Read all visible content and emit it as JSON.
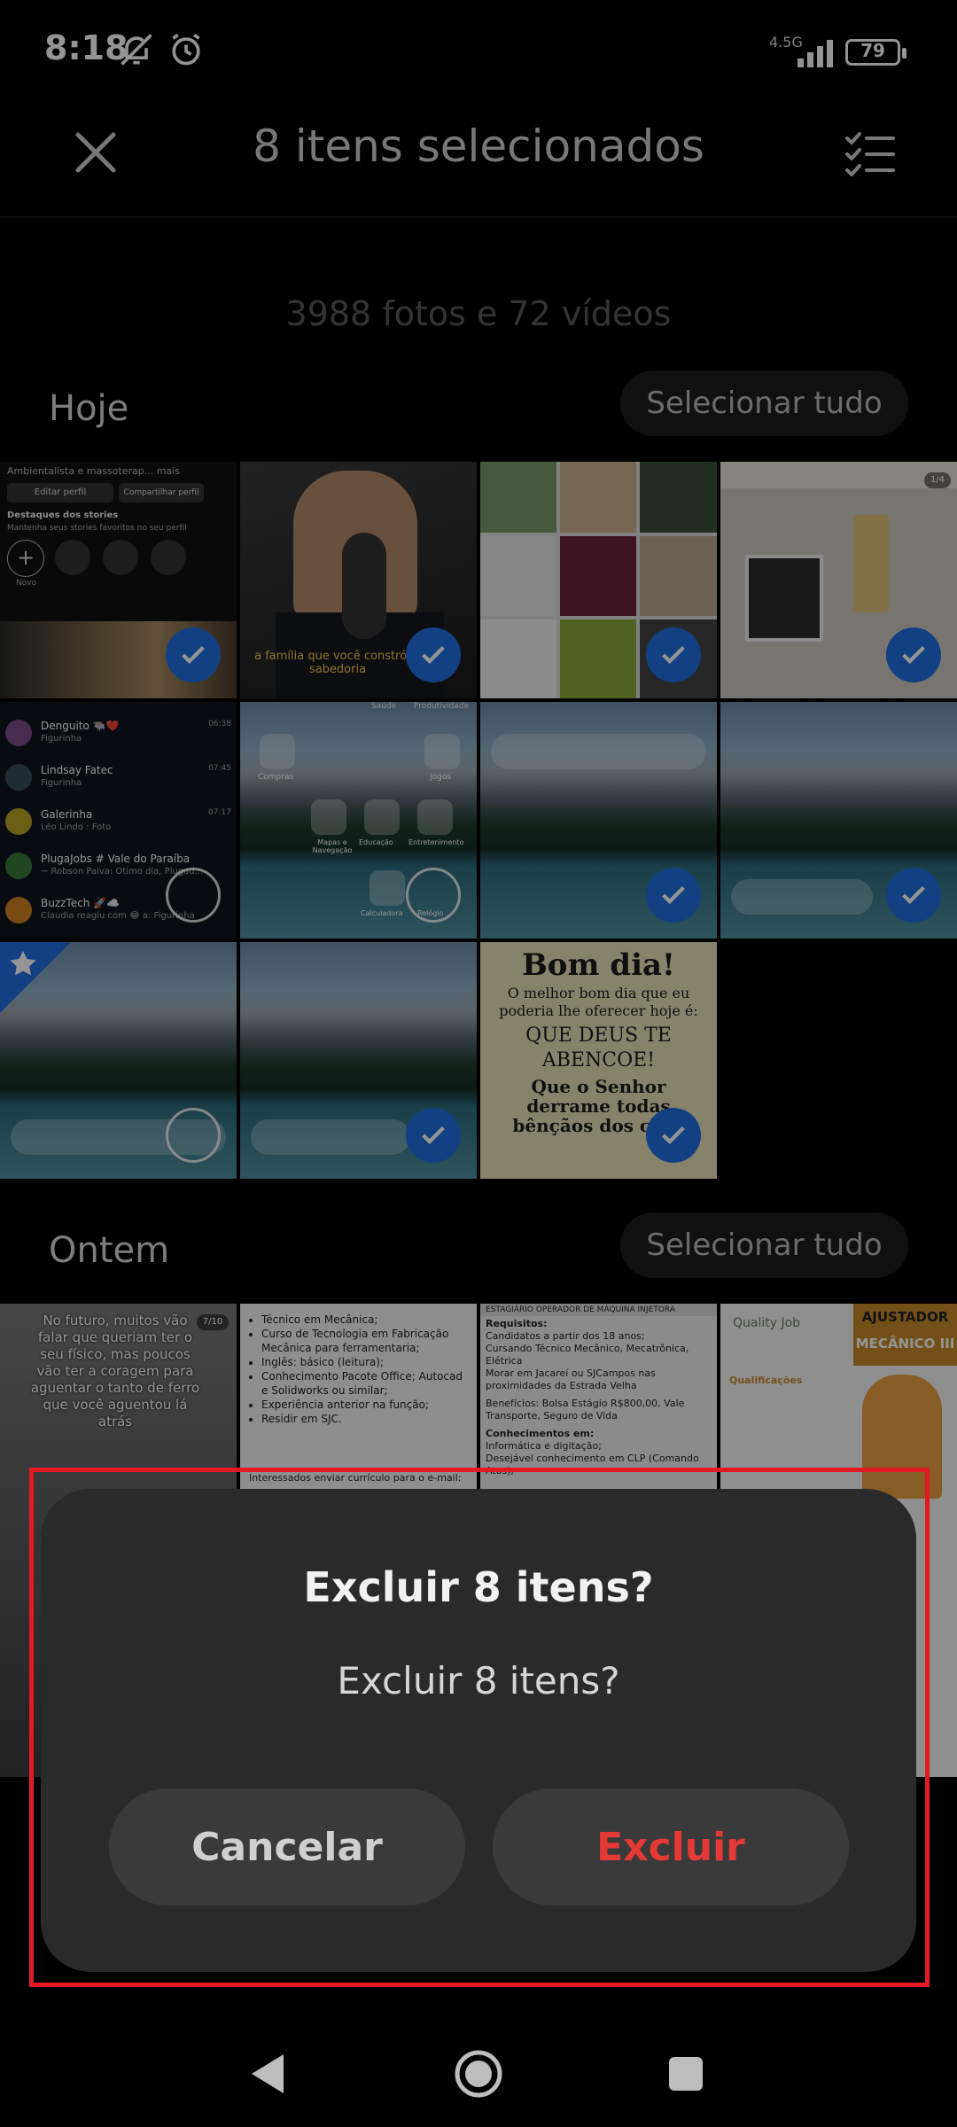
{
  "status_bar": {
    "time": "8:18",
    "network": "4.5G",
    "battery": "79",
    "icons": [
      "bell-off-icon",
      "alarm-icon",
      "signal-icon",
      "battery-icon"
    ]
  },
  "header": {
    "title": "8 itens selecionados",
    "close_icon": "close-icon",
    "select_icon": "checklist-icon"
  },
  "summary": "3988 fotos e 72 vídeos",
  "sections": [
    {
      "title": "Hoje",
      "select_all": "Selecionar tudo",
      "tiles": [
        {
          "name": "instagram-profile",
          "state": "selected"
        },
        {
          "name": "podcast-man",
          "state": "selected",
          "caption": "a família que você constrói é sabedoria"
        },
        {
          "name": "collage",
          "state": "selected"
        },
        {
          "name": "man-on-ladder",
          "state": "selected",
          "badge": "1/4"
        },
        {
          "name": "chat-list",
          "state": "unselected"
        },
        {
          "name": "home-screen-apps",
          "state": "unselected"
        },
        {
          "name": "landscape-search",
          "state": "selected"
        },
        {
          "name": "landscape-2",
          "state": "selected"
        },
        {
          "name": "landscape-favorite",
          "state": "unselected"
        },
        {
          "name": "landscape-3",
          "state": "selected"
        },
        {
          "name": "bom-dia-card",
          "state": "selected"
        }
      ],
      "chat_list": [
        {
          "name": "Denguito 🐃❤️",
          "preview": "Figurinha",
          "time": "06:38"
        },
        {
          "name": "Lindsay Fatec",
          "preview": "Figurinha",
          "time": "07:45"
        },
        {
          "name": "Galerinha",
          "preview": "Léo Lindo : Foto",
          "time": "07:17"
        },
        {
          "name": "PlugaJobs # Vale do Paraíba",
          "preview": "~ Robson Paiva: Ótimo dia, Plugad...",
          "time": ""
        },
        {
          "name": "BuzzTech 🚀☁️",
          "preview": "Claudia reagiu com 😂 a: Figurinha",
          "time": ""
        }
      ],
      "profile": {
        "bio": "Ambientalista e massoterap... mais",
        "edit": "Editar perfil",
        "share": "Compartilhar perfil",
        "highlights_title": "Destaques dos stories",
        "highlights_sub": "Mantenha seus stories favoritos no seu perfil",
        "new": "Novo"
      },
      "home_apps": [
        "Compras",
        "Jogos",
        "Mapas e Navegação",
        "Educação",
        "Entretenimento",
        "Calculadora",
        "Relógio",
        "Saúde",
        "Produtividade"
      ],
      "bom_dia": {
        "title": "Bom dia!",
        "line1": "O melhor bom dia que eu poderia lhe oferecer hoje é:",
        "line2": "QUE DEUS TE ABENCOE!",
        "line3": "Que o Senhor derrame todas bênçãos dos céus"
      }
    },
    {
      "title": "Ontem",
      "select_all": "Selecionar tudo",
      "tiles": [
        {
          "name": "motivational-text",
          "text": "No futuro, muitos vão falar que queriam ter o seu físico, mas poucos vão ter a coragem para aguentar o tanto de ferro que você aguentou lá atrás",
          "badge": "7/10"
        },
        {
          "name": "job-list",
          "lines": [
            "Técnico em Mecânica;",
            "Curso de Tecnologia em Fabricação Mecânica para ferramentaria;",
            "Inglês: básico (leitura);",
            "Conhecimento Pacote Office; Autocad e Solidworks ou similar;",
            "Experiência anterior na função;",
            "Residir em SJC."
          ],
          "footer": "Interessados enviar currículo para o e-mail:"
        },
        {
          "name": "job-requirements",
          "header": "ESTAGIÁRIO OPERADOR DE MÁQUINA INJETORA",
          "lines": [
            "Requisitos:",
            "Candidatos a partir dos 18 anos;",
            "Cursando Técnico Mecânico, Mecatrônica, Elétrica",
            "Morar em Jacareí ou SJCampos nas proximidades da Estrada Velha",
            "Benefícios: Bolsa Estágio R$800,00, Vale Transporte, Seguro de Vida",
            "Conhecimentos em:",
            "Informática e digitação;",
            "Desejável conhecimento em CLP (Comando Atos);"
          ]
        },
        {
          "name": "quality-job",
          "brand": "Quality Job",
          "title1": "AJUSTADOR",
          "title2": "MECÂNICO III",
          "sub": "Qualificações"
        }
      ]
    }
  ],
  "dialog": {
    "title": "Excluir 8 itens?",
    "message": "Excluir 8 itens?",
    "cancel": "Cancelar",
    "confirm": "Excluir"
  },
  "colors": {
    "accent": "#1f6fe0",
    "danger": "#e53935",
    "highlight": "#e11a24"
  }
}
